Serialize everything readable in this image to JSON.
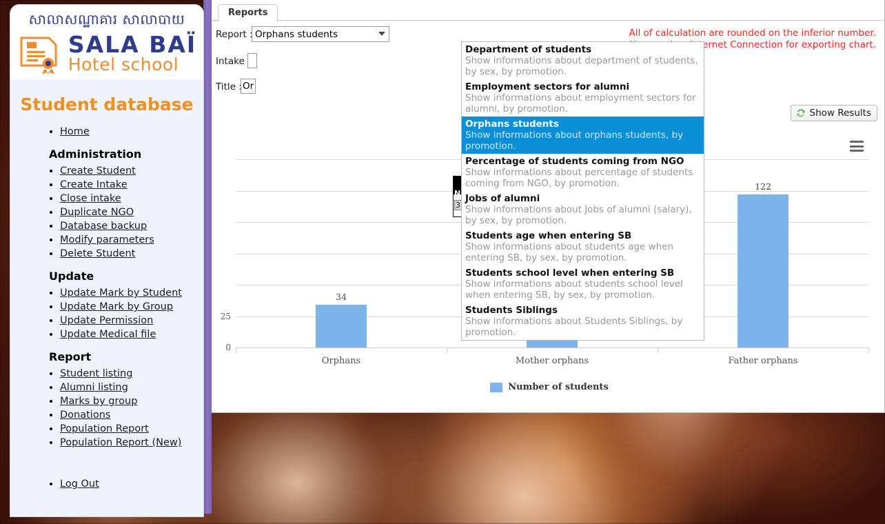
{
  "sidebar": {
    "logo": {
      "khmer": "សាលាសណ្ឋាគារ សាលាបាយ",
      "name": "SALA BAÏ",
      "tagline": "Hotel school",
      "icon": "certificate-document-icon"
    },
    "title": "Student database",
    "home_label": "Home",
    "sections": [
      {
        "heading": "Administration",
        "items": [
          "Create Student",
          "Create Intake",
          "Close intake",
          "Duplicate NGO",
          "Database backup",
          "Modify parameters",
          "Delete Student"
        ]
      },
      {
        "heading": "Update",
        "items": [
          "Update Mark by Student",
          "Update Mark by Group",
          "Update Permission",
          "Update Medical file"
        ]
      },
      {
        "heading": "Report",
        "items": [
          "Student listing",
          "Alumni listing",
          "Marks by group",
          "Donations",
          "Population Report",
          "Population Report (New)"
        ]
      }
    ],
    "logout_label": "Log Out"
  },
  "content": {
    "tab_label": "Reports",
    "labels": {
      "report": "Report :",
      "intake": "Intake :",
      "title": "Title :"
    },
    "report_select_value": "Orphans students",
    "title_field_value": "Or",
    "warning_line1": "All of calculation are rounded on the inferior number.",
    "warning_line2": "You need an Internet Connection for exporting chart.",
    "show_results_label": "Show Results",
    "show_results_icon": "refresh-arrows-icon",
    "warning_color": "#ff2222"
  },
  "dropdown": {
    "selected_index": 2,
    "options": [
      {
        "label": "Department of students",
        "desc": "Show informations about department of students, by sex, by promotion."
      },
      {
        "label": "Employment sectors for alumni",
        "desc": "Show informations about employment sectors for alumni, by promotion."
      },
      {
        "label": "Orphans students",
        "desc": "Show informations about orphans students, by promotion."
      },
      {
        "label": "Percentage of students coming from NGO",
        "desc": "Show informations about percentage of students coming from NGO, by promotion."
      },
      {
        "label": "Jobs of alumni",
        "desc": "Show informations about Jobs of alumni (salary), by sex, by promotion."
      },
      {
        "label": "Students age when entering SB",
        "desc": "Show informations about students age when entering SB, by sex, by promotion."
      },
      {
        "label": "Students school level when entering SB",
        "desc": "Show informations about students school level when entering SB, by sex, by promotion."
      },
      {
        "label": "Students Siblings",
        "desc": "Show informations about Students Siblings, by promotion."
      }
    ]
  },
  "mini_widget": {
    "letter": "N",
    "number": "3"
  },
  "chart_data": {
    "type": "bar",
    "title": "Orphans students",
    "categories": [
      "Orphans",
      "Mother orphans",
      "Father orphans"
    ],
    "values": [
      34,
      34,
      122
    ],
    "series": [
      {
        "name": "Number of students",
        "values": [
          34,
          34,
          122
        ]
      }
    ],
    "xlabel": "",
    "ylabel": "",
    "ylim": [
      0,
      150
    ],
    "yticks": [
      0,
      25,
      50,
      75,
      100,
      125,
      150
    ],
    "visible_yticks": [
      "0",
      "25"
    ],
    "grid": true,
    "legend_position": "bottom",
    "bar_color": "#7cb5ec",
    "menu_icon": "hamburger-menu-icon"
  }
}
